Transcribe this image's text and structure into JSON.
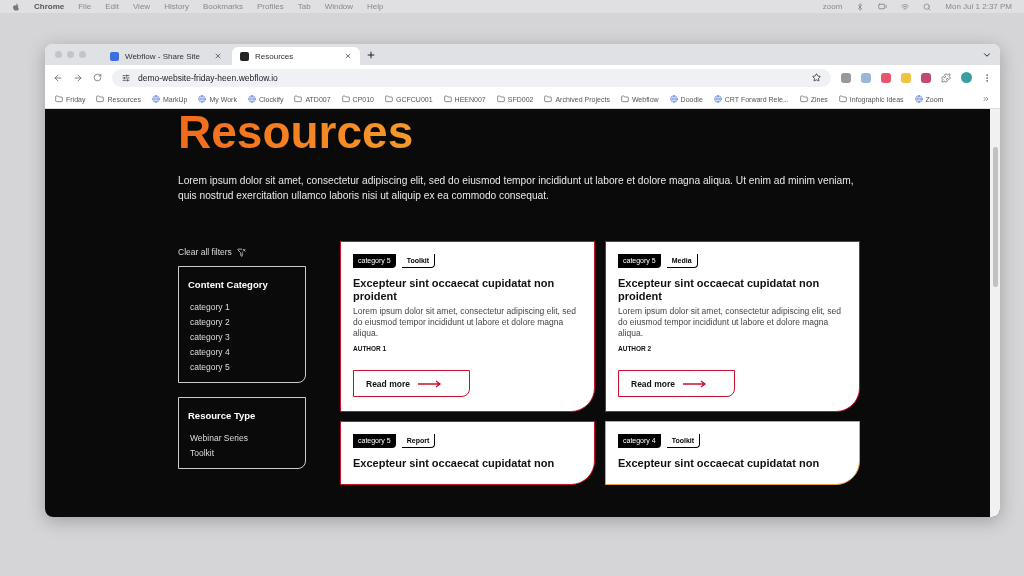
{
  "menu_bar": {
    "app": "Chrome",
    "items": [
      "File",
      "Edit",
      "View",
      "History",
      "Bookmarks",
      "Profiles",
      "Tab",
      "Window",
      "Help"
    ],
    "status_text": "zoom",
    "clock": "Mon Jul 1  2:37 PM"
  },
  "tabs": [
    {
      "label": "Webflow - Share Site",
      "selected": false
    },
    {
      "label": "Resources",
      "selected": true
    }
  ],
  "address_bar": {
    "url": "demo-website-friday-heen.webflow.io"
  },
  "bookmarks": [
    {
      "label": "Friday",
      "kind": "folder"
    },
    {
      "label": "Resources",
      "kind": "folder"
    },
    {
      "label": "MarkUp",
      "kind": "site"
    },
    {
      "label": "My Work",
      "kind": "site"
    },
    {
      "label": "Clockify",
      "kind": "site"
    },
    {
      "label": "ATD007",
      "kind": "folder"
    },
    {
      "label": "CP010",
      "kind": "folder"
    },
    {
      "label": "GCFCU001",
      "kind": "folder"
    },
    {
      "label": "HEEN007",
      "kind": "folder"
    },
    {
      "label": "SFD002",
      "kind": "folder"
    },
    {
      "label": "Archived Projects",
      "kind": "folder"
    },
    {
      "label": "Webflow",
      "kind": "folder"
    },
    {
      "label": "Doodle",
      "kind": "site"
    },
    {
      "label": "CRT Forward Rele...",
      "kind": "site"
    },
    {
      "label": "Zines",
      "kind": "folder"
    },
    {
      "label": "Infographic Ideas",
      "kind": "folder"
    },
    {
      "label": "Zoom",
      "kind": "site"
    }
  ],
  "page": {
    "heading": "Resources",
    "intro": "Lorem ipsum dolor sit amet, consectetur adipiscing elit, sed do eiusmod tempor incididunt ut labore et dolore magna aliqua. Ut enim ad minim veniam, quis nostrud exercitation ullamco laboris nisi ut aliquip ex ea commodo consequat.",
    "clear_filters": "Clear all filters",
    "filter_groups": [
      {
        "title": "Content Category",
        "options": [
          "category 1",
          "category 2",
          "category 3",
          "category 4",
          "category 5"
        ]
      },
      {
        "title": "Resource Type",
        "options": [
          "Webinar Series",
          "Toolkit"
        ]
      }
    ],
    "cards": [
      {
        "category": "category 5",
        "type": "Toolkit",
        "title": "Excepteur sint occaecat cupidatat non proident",
        "text": "Lorem ipsum dolor sit amet, consectetur adipiscing elit, sed do eiusmod tempor incididunt ut labore et dolore magna aliqua.",
        "author": "AUTHOR 1",
        "button": "Read more",
        "color": "#c8102e"
      },
      {
        "category": "category 5",
        "type": "Media",
        "title": "Excepteur sint occaecat cupidatat non proident",
        "text": "Lorem ipsum dolor sit amet, consectetur adipiscing elit, sed do eiusmod tempor incididunt ut labore et dolore magna aliqua.",
        "author": "AUTHOR 2",
        "button": "Read more",
        "color": "#c8102e"
      },
      {
        "category": "category 5",
        "type": "Report",
        "title": "Excepteur sint occaecat cupidatat non",
        "color": "#c8102e"
      },
      {
        "category": "category 4",
        "type": "Toolkit",
        "title": "Excepteur sint occaecat cupidatat non",
        "color": "#e8a03a"
      }
    ]
  }
}
